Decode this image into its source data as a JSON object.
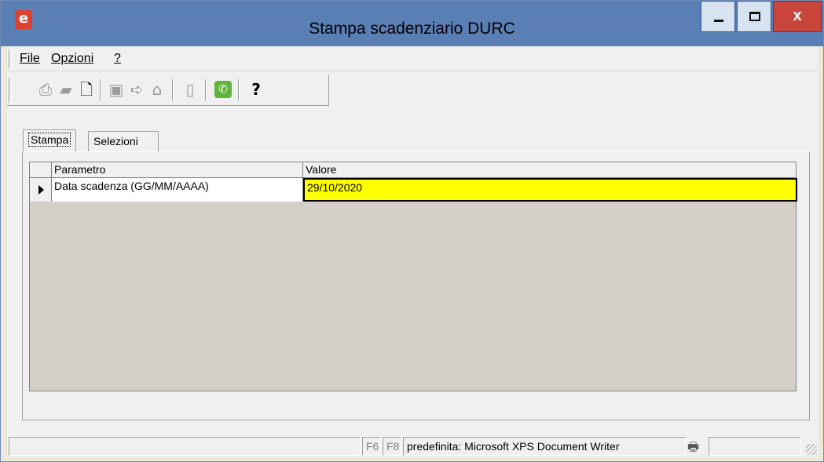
{
  "window": {
    "title": "Stampa scadenziario DURC",
    "app_icon": "e",
    "close_glyph": "x"
  },
  "menu": {
    "items": [
      {
        "label": "File"
      },
      {
        "label": "Opzioni"
      },
      {
        "label": "?"
      }
    ]
  },
  "toolbar": {
    "icons": [
      "print-icon",
      "print-setup-icon",
      "print-preview-icon",
      "export-icon",
      "send-icon",
      "archive-icon",
      "copy-icon",
      "phone-icon",
      "help-icon"
    ]
  },
  "tabs": [
    {
      "label": "Stampa",
      "active": true
    },
    {
      "label": "Selezioni",
      "active": false
    }
  ],
  "grid": {
    "columns": [
      "Parametro",
      "Valore"
    ],
    "rows": [
      {
        "parameter": "Data scadenza (GG/MM/AAAA)",
        "value": "29/10/2020"
      }
    ]
  },
  "statusbar": {
    "f6": "F6",
    "f8": "F8",
    "printer": "predefinita: Microsoft XPS Document Writer"
  },
  "colors": {
    "title_bar": "#5a7fb5",
    "close_button": "#c9453c",
    "highlight_cell": "#ffff00",
    "grid_background": "#d4d0c8"
  }
}
